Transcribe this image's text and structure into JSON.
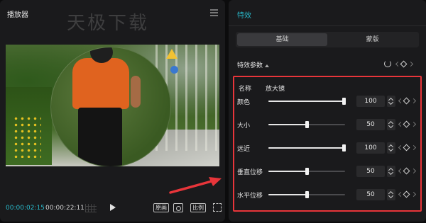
{
  "player": {
    "title": "播放器",
    "watermark": "天极下载",
    "current_time": "00:00:02:15",
    "total_time": "00:00:22:11",
    "original_button": "原画",
    "ratio_button": "比例",
    "icons": [
      "menu-icon",
      "grid-icon",
      "play-icon",
      "focus-icon",
      "fullscreen-icon"
    ]
  },
  "effects": {
    "title": "特效",
    "tabs": [
      {
        "label": "基础",
        "active": true
      },
      {
        "label": "蒙版",
        "active": false
      }
    ],
    "section_title": "特效参数",
    "name_label": "名称",
    "name_value": "放大镜",
    "params": [
      {
        "label": "颜色",
        "value": "100",
        "fraction": 1.0
      },
      {
        "label": "大小",
        "value": "50",
        "fraction": 0.5
      },
      {
        "label": "远近",
        "value": "100",
        "fraction": 1.0
      },
      {
        "label": "垂直位移",
        "value": "50",
        "fraction": 0.5
      },
      {
        "label": "水平位移",
        "value": "50",
        "fraction": 0.5
      }
    ]
  },
  "colors": {
    "accent": "#29b8c9",
    "highlight_box": "#e8353a",
    "panel": "#1a1a1c",
    "background": "#0c0c0d"
  }
}
